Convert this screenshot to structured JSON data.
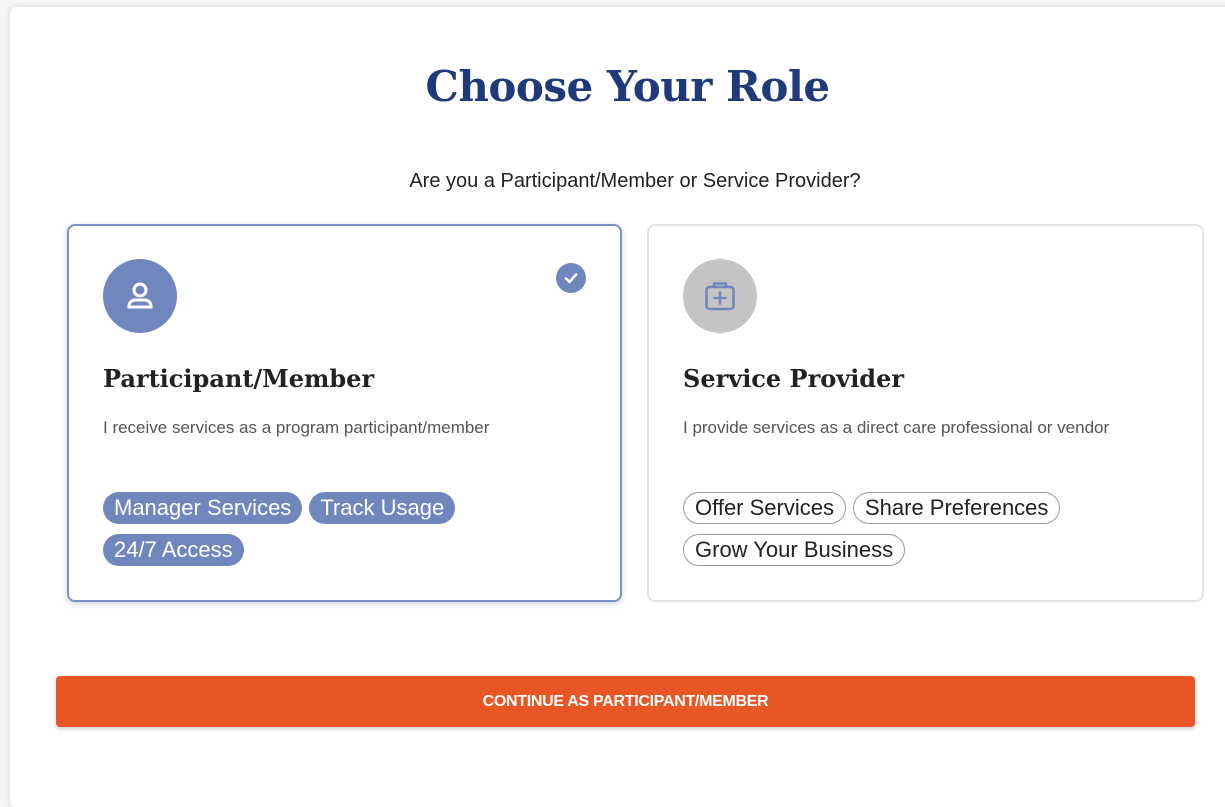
{
  "page": {
    "title": "Choose Your Role",
    "subtitle": "Are you a Participant/Member or Service Provider?"
  },
  "roles": [
    {
      "id": "participant",
      "selected": true,
      "icon": "person-icon",
      "title": "Participant/Member",
      "description": "I receive services as a program participant/member",
      "tags": [
        "Manager Services",
        "Track Usage",
        "24/7 Access"
      ]
    },
    {
      "id": "provider",
      "selected": false,
      "icon": "medical-kit-icon",
      "title": "Service Provider",
      "description": "I provide services as a direct care professional or vendor",
      "tags": [
        "Offer Services",
        "Share Preferences",
        "Grow Your Business"
      ]
    }
  ],
  "actions": {
    "continue_label": "CONTINUE AS PARTICIPANT/MEMBER"
  },
  "colors": {
    "title": "#1f3a7a",
    "selected_accent": "#6f87bd",
    "unselected_icon_bg": "#c4c4c4",
    "continue_button": "#e85625"
  }
}
